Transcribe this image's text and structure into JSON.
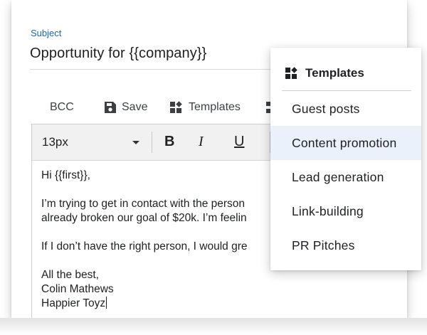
{
  "subject": {
    "label": "Subject",
    "value": "Opportunity for {{company}}"
  },
  "toolbar": {
    "bcc_label": "BCC",
    "save_label": "Save",
    "templates_label": "Templates"
  },
  "editor": {
    "font_size": "13px",
    "bold_label": "B",
    "italic_label": "I",
    "underline_label": "U",
    "body": {
      "greeting": "Hi {{first}},",
      "para1_line1": "I’m trying to get in contact with the person",
      "para1_line2": "already broken our goal of $20k. I’m feelin",
      "para2": "If I don’t have the right person, I would gre",
      "signoff": "All the best,",
      "name": "Colin Mathews",
      "company": "Happier Toyz"
    }
  },
  "templates_menu": {
    "header": "Templates",
    "items": [
      {
        "label": "Guest posts",
        "active": false
      },
      {
        "label": "Content promotion",
        "active": true
      },
      {
        "label": "Lead generation",
        "active": false
      },
      {
        "label": "Link-building",
        "active": false
      },
      {
        "label": "PR Pitches",
        "active": false
      }
    ]
  },
  "colors": {
    "subject_label": "#1a66b8",
    "menu_active_bg": "#eaf1fb"
  }
}
